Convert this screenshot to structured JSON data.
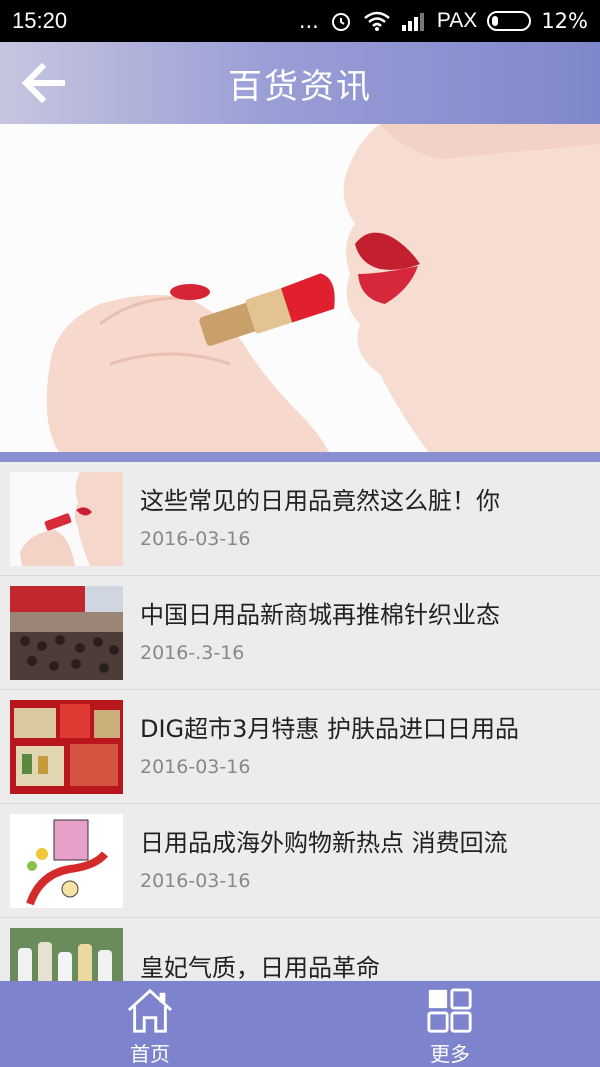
{
  "status_bar": {
    "time": "15:20",
    "dots": "...",
    "carrier": "PAX",
    "battery": "12%"
  },
  "header": {
    "title": "百货资讯",
    "back_icon": "back-arrow-icon"
  },
  "news": [
    {
      "title": "这些常见的日用品竟然这么脏！你",
      "date": "2016-03-16",
      "thumb": "lipstick"
    },
    {
      "title": "中国日用品新商城再推棉针织业态",
      "date": "2016-.3-16",
      "thumb": "crowd"
    },
    {
      "title": "DIG超市3月特惠 护肤品进口日用品",
      "date": "2016-03-16",
      "thumb": "products"
    },
    {
      "title": "日用品成海外购物新热点 消费回流",
      "date": "2016-03-16",
      "thumb": "cartoon"
    },
    {
      "title": "皇妃气质，日用品革命",
      "date": "",
      "thumb": "bottles"
    }
  ],
  "nav": {
    "home_label": "首页",
    "more_label": "更多"
  },
  "colors": {
    "header_start": "#c6c6df",
    "header_end": "#7f87cc",
    "nav_bg": "#7d83cd"
  }
}
